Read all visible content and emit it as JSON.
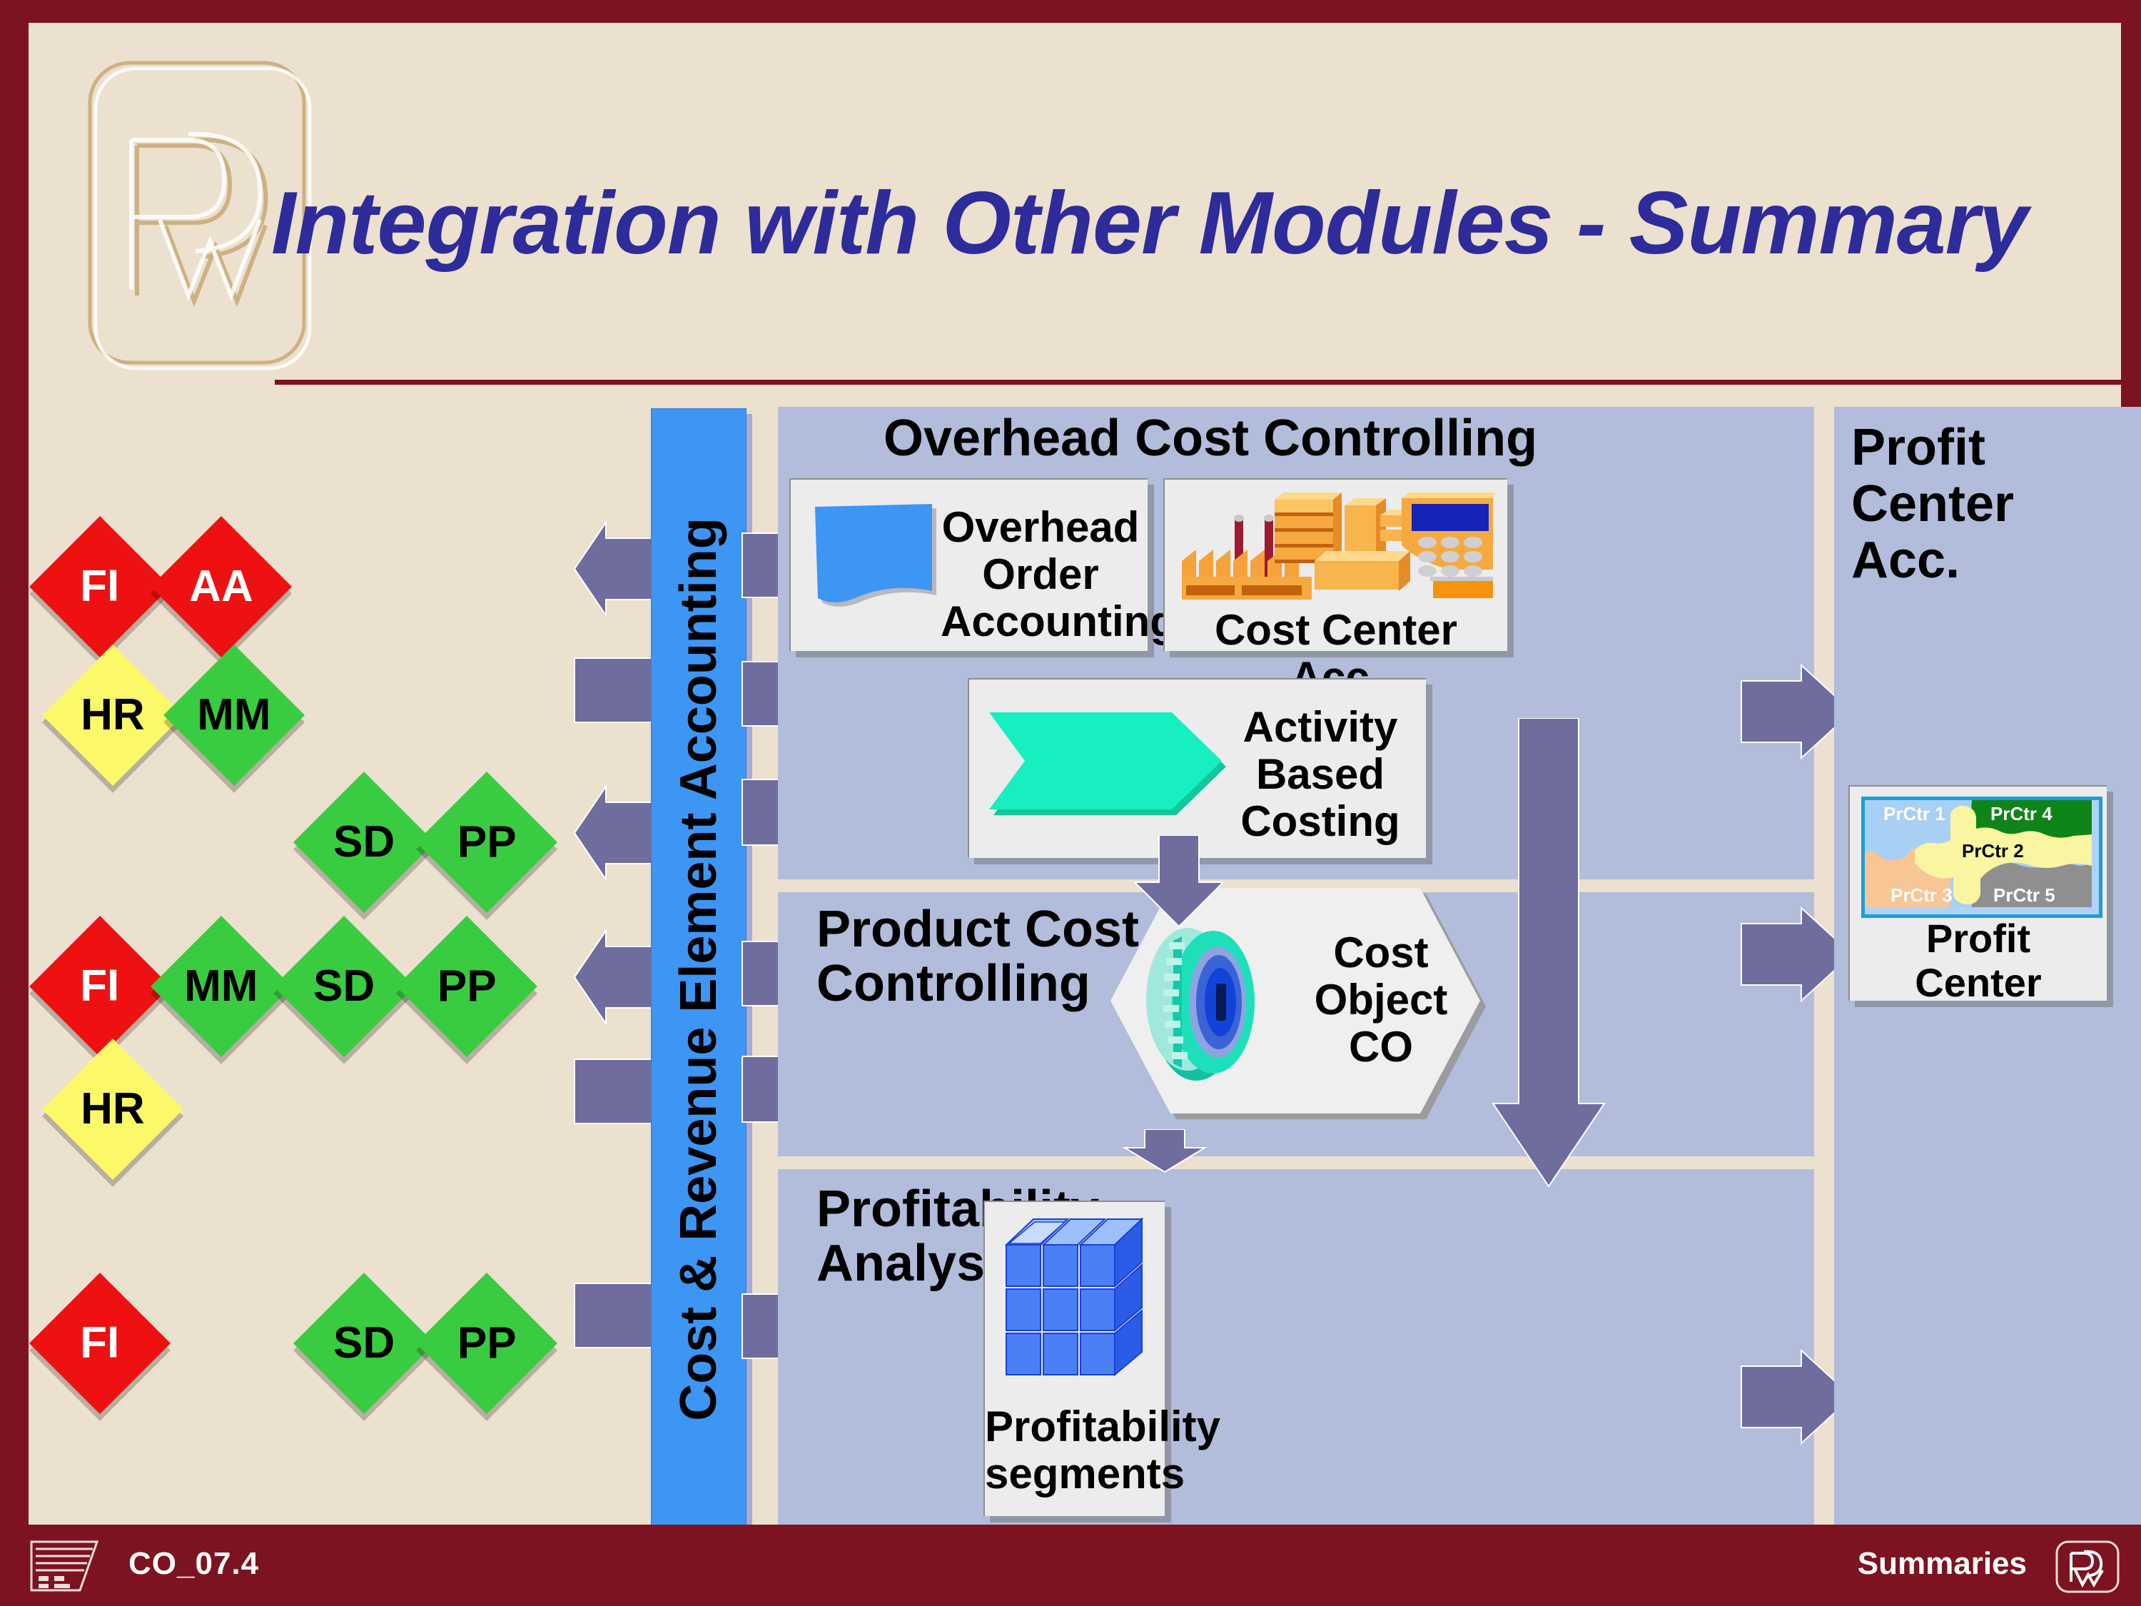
{
  "slide": {
    "title": "Integration with Other Modules - Summary",
    "footer_id": "CO_07.4",
    "footer_right": "Summaries",
    "logo_text": "PwC"
  },
  "colors": {
    "frame": "#7d1320",
    "canvas": "#ece0cf",
    "title": "#2e2b9b",
    "panel": "#b1bdda",
    "card": "#ececec",
    "bar_blue": "#3d95f4",
    "arrow_purple": "#6f6c9e",
    "diamond_red": "#ef1111",
    "diamond_green": "#39cc41",
    "diamond_yellow": "#fbf96a",
    "abc_teal": "#16f0c0",
    "cube_blue": "#4a7ff5"
  },
  "vertical_bar": {
    "label": "Cost & Revenue Element Accounting"
  },
  "module_rows": [
    {
      "row": 1,
      "modules": [
        {
          "code": "FI",
          "color": "red"
        },
        {
          "code": "AA",
          "color": "red"
        }
      ]
    },
    {
      "row": 2,
      "modules": [
        {
          "code": "HR",
          "color": "yellow"
        },
        {
          "code": "MM",
          "color": "green"
        }
      ]
    },
    {
      "row": 3,
      "modules": [
        {
          "code": "SD",
          "color": "green"
        },
        {
          "code": "PP",
          "color": "green"
        }
      ]
    },
    {
      "row": 4,
      "modules": [
        {
          "code": "FI",
          "color": "red"
        },
        {
          "code": "MM",
          "color": "green"
        },
        {
          "code": "SD",
          "color": "green"
        },
        {
          "code": "PP",
          "color": "green"
        }
      ]
    },
    {
      "row": 5,
      "modules": [
        {
          "code": "HR",
          "color": "yellow"
        }
      ]
    },
    {
      "row": 6,
      "modules": [
        {
          "code": "FI",
          "color": "red"
        },
        {
          "code": "SD",
          "color": "green"
        },
        {
          "code": "PP",
          "color": "green"
        }
      ]
    }
  ],
  "panels": {
    "overhead": {
      "title": "Overhead Cost Controlling",
      "cards": [
        {
          "label": "Overhead\nOrder\nAccounting",
          "icon": "order-document-icon"
        },
        {
          "label": "Cost Center Acc.",
          "icon": "factory-cash-register-icon"
        },
        {
          "label": "Activity\nBased\nCosting",
          "icon": "chevron-process-icon"
        }
      ]
    },
    "product_cost": {
      "title": "Product Cost\nControlling",
      "cards": [
        {
          "label": "Cost\nObject\nCO",
          "icon": "gear-icon"
        }
      ]
    },
    "profitability": {
      "title": "Profitability\nAnalysis",
      "cards": [
        {
          "label": "Profitability\nsegments",
          "icon": "cube-grid-icon"
        }
      ]
    },
    "profit_center": {
      "title": "Profit\nCenter\nAcc.",
      "card_label": "Profit\nCenter",
      "map_regions": [
        {
          "name": "PrCtr 1",
          "color": "#a8d0f5"
        },
        {
          "name": "PrCtr 4",
          "color": "#0f8418"
        },
        {
          "name": "PrCtr 2",
          "color": "#f9f5a0"
        },
        {
          "name": "PrCtr 3",
          "color": "#f8c694"
        },
        {
          "name": "PrCtr 5",
          "color": "#8f8f8f"
        }
      ]
    }
  }
}
